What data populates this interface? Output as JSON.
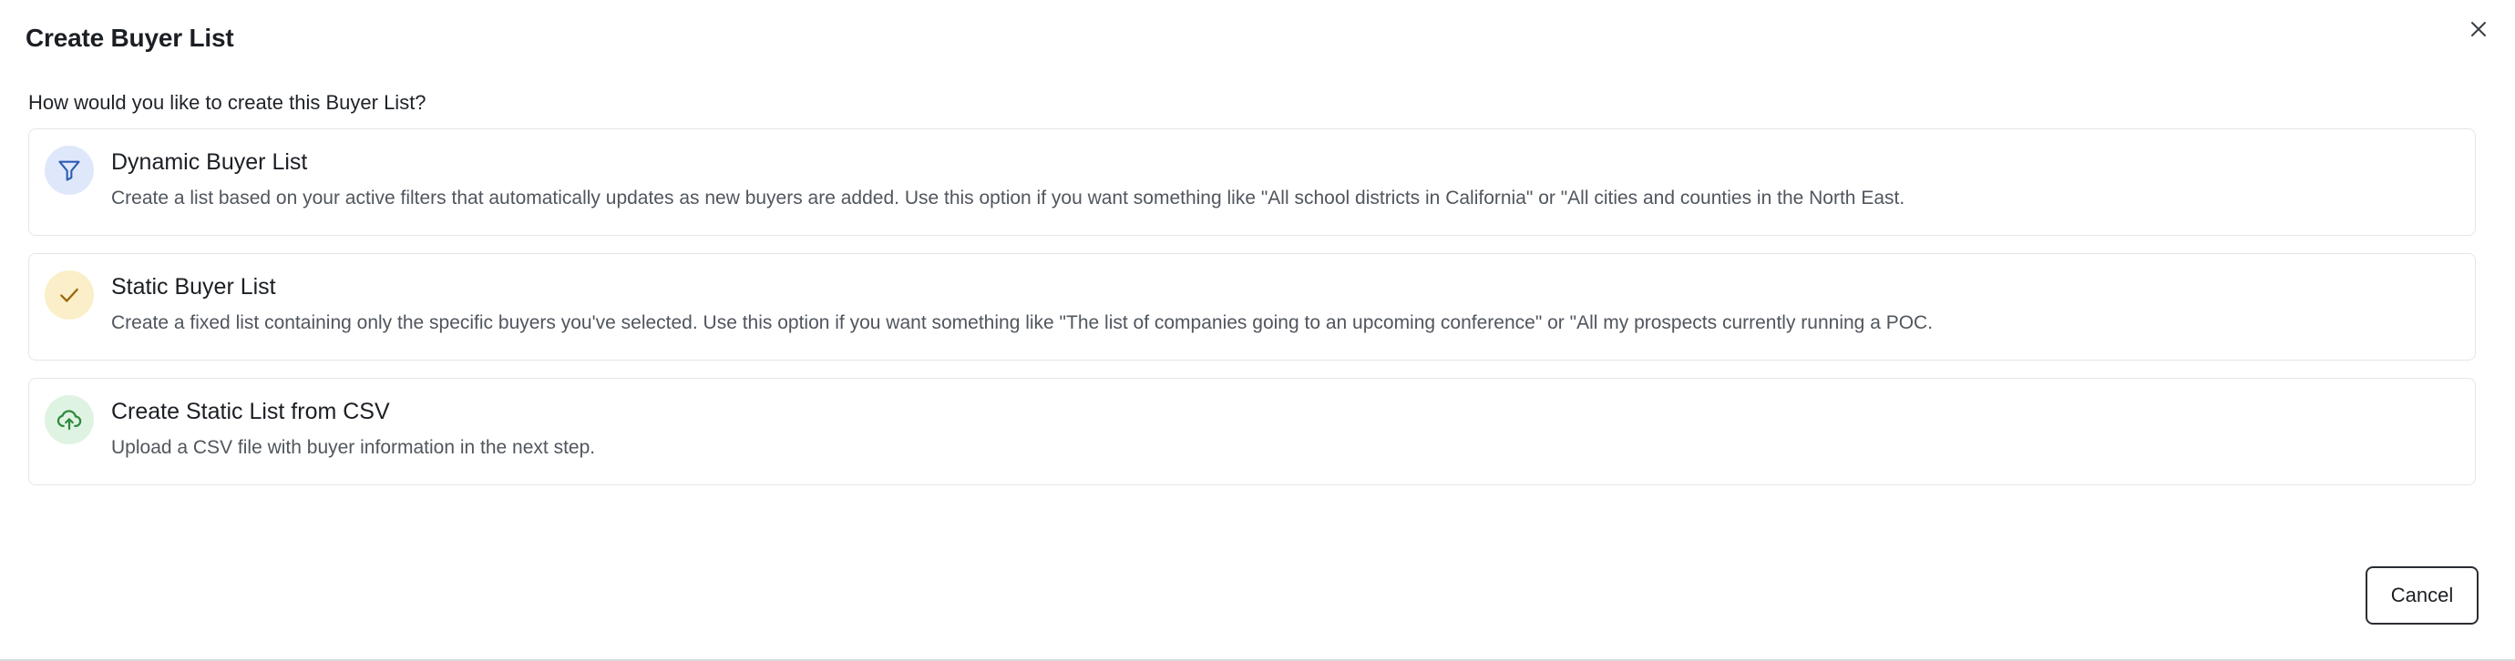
{
  "dialog": {
    "title": "Create Buyer List",
    "question": "How would you like to create this Buyer List?",
    "close_icon": "close-icon",
    "cancel_label": "Cancel"
  },
  "options": [
    {
      "title": "Dynamic Buyer List",
      "description": "Create a list based on your active filters that automatically updates as new buyers are added. Use this option if you want something like \"All school districts in California\" or \"All cities and counties in the North East.",
      "icon": "filter-icon",
      "icon_color": "#2e5bb5",
      "icon_bg": "#dfe8fa"
    },
    {
      "title": "Static Buyer List",
      "description": "Create a fixed list containing only the specific buyers you've selected. Use this option if you want something like \"The list of companies going to an upcoming conference\" or \"All my prospects currently running a POC.",
      "icon": "check-icon",
      "icon_color": "#9a6a10",
      "icon_bg": "#fbefc9"
    },
    {
      "title": "Create Static List from CSV",
      "description": "Upload a CSV file with buyer information in the next step.",
      "icon": "cloud-upload-icon",
      "icon_color": "#2f8a3e",
      "icon_bg": "#dff3e2"
    }
  ]
}
